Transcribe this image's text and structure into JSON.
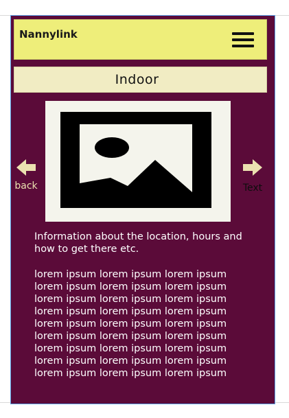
{
  "app": {
    "title": "Nannylink",
    "menu_icon": "hamburger-menu-icon"
  },
  "section": {
    "title": "Indoor"
  },
  "image": {
    "icon": "image-placeholder-icon"
  },
  "nav": {
    "back_label": "back",
    "back_icon": "arrow-left-icon",
    "next_label": "Text",
    "next_icon": "arrow-right-icon"
  },
  "content": {
    "info": "Information about the location, hours and how to get there etc.",
    "lorem": "lorem ipsum lorem ipsum lorem ipsum lorem ipsum lorem ipsum lorem ipsum lorem ipsum lorem ipsum lorem ipsum lorem ipsum lorem ipsum lorem ipsum lorem ipsum lorem ipsum lorem ipsum lorem ipsum lorem ipsum lorem ipsum lorem ipsum lorem ipsum lorem ipsum lorem ipsum lorem ipsum lorem ipsum lorem ipsum lorem ipsum lorem ipsum"
  },
  "colors": {
    "background": "#5b0b39",
    "header": "#eeee7a",
    "section_bar": "#f1ecc3",
    "arrow": "#ebe1b0",
    "frame_border": "#5aa0e6"
  }
}
